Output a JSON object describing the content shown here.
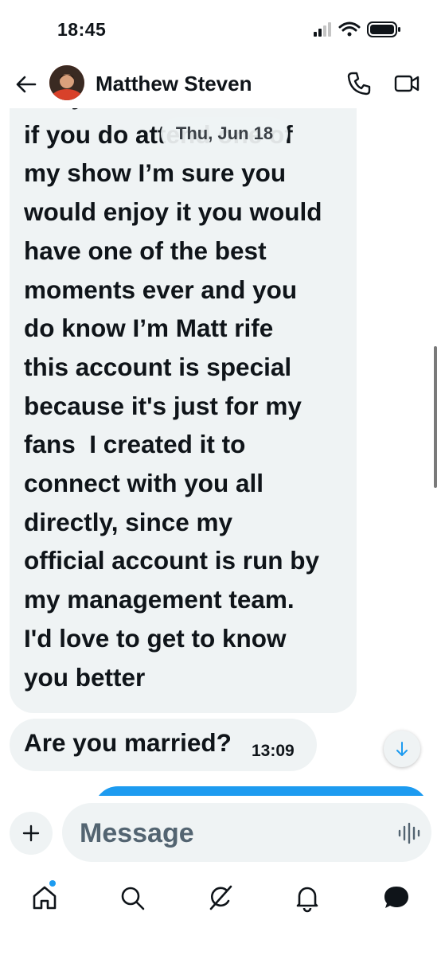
{
  "status": {
    "time": "18:45"
  },
  "header": {
    "contact_name": "Matthew Steven"
  },
  "chat": {
    "date_pill": "Thu, Jun 18",
    "messages": [
      {
        "text": "Okay that's sad I'd love\nif you do attend one of\nmy show I’m sure you\nwould enjoy it you would\nhave one of the best\nmoments ever and you\ndo know I’m Matt rife\nthis account is special\nbecause it's just for my\nfans  I created it to\nconnect with you all\ndirectly, since my\nofficial account is run by\nmy management team.\nI'd love to get to know\nyou better"
      },
      {
        "text": "Are you married?",
        "time": "13:09"
      }
    ]
  },
  "composer": {
    "placeholder": "Message"
  },
  "colors": {
    "accent": "#1d9bf0",
    "bubble_in": "#eff3f4",
    "text": "#0f1419"
  },
  "icons": [
    "back-arrow-icon",
    "phone-icon",
    "video-icon",
    "scroll-down-icon",
    "plus-icon",
    "voice-icon",
    "home-icon",
    "search-icon",
    "grok-icon",
    "bell-icon",
    "messages-icon"
  ]
}
